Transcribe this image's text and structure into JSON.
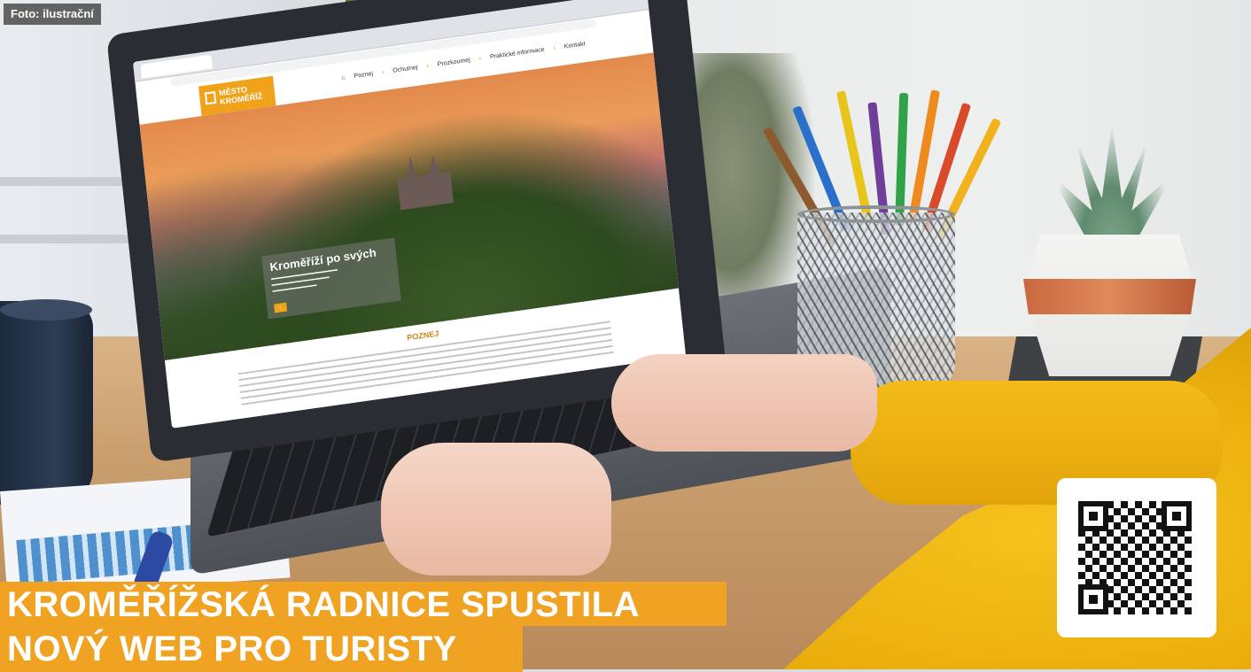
{
  "photo_credit": "Foto: ilustrační",
  "headline": {
    "line1": "KROMĚŘÍŽSKÁ RADNICE SPUSTILA",
    "line2": "NOVÝ WEB PRO TURISTY"
  },
  "website": {
    "logo_line1": "MĚSTO",
    "logo_line2": "KROMĚŘÍŽ",
    "nav": [
      "Poznej",
      "Ochutnej",
      "Prozkoumej",
      "Praktické informace",
      "Kontakt"
    ],
    "hero_title": "Kroměříží po svých",
    "section_title": "POZNEJ"
  },
  "qr": {
    "label": "qr-code"
  }
}
